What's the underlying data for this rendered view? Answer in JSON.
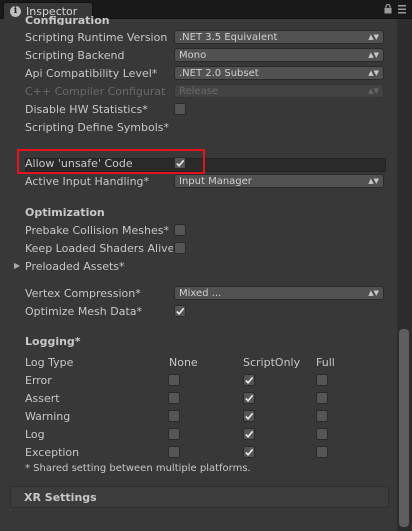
{
  "tab": {
    "title": "Inspector",
    "icon": "info-icon"
  },
  "tab_tools": {
    "lock": "lock-icon",
    "menu": "menu-icon"
  },
  "section_cut_title": "Configuration",
  "config": {
    "scripting_runtime_label": "Scripting Runtime Version",
    "scripting_runtime_value": ".NET 3.5 Equivalent",
    "scripting_backend_label": "Scripting Backend",
    "scripting_backend_value": "Mono",
    "api_compat_label": "Api Compatibility Level*",
    "api_compat_value": ".NET 2.0 Subset",
    "cpp_compiler_label": "C++ Compiler Configurat",
    "cpp_compiler_value": "Release",
    "disable_hw_label": "Disable HW Statistics*",
    "define_symbols_label": "Scripting Define Symbols*",
    "define_symbols_value": "",
    "allow_unsafe_label": "Allow 'unsafe' Code",
    "active_input_label": "Active Input Handling*",
    "active_input_value": "Input Manager"
  },
  "optimization": {
    "title": "Optimization",
    "prebake_label": "Prebake Collision Meshes*",
    "keep_loaded_label": "Keep Loaded Shaders Alive*",
    "preloaded_label": "Preloaded Assets*",
    "vertex_comp_label": "Vertex Compression*",
    "vertex_comp_value": "Mixed ...",
    "optimize_mesh_label": "Optimize Mesh Data*"
  },
  "logging": {
    "title": "Logging*",
    "col_type": "Log Type",
    "col_none": "None",
    "col_script": "ScriptOnly",
    "col_full": "Full",
    "rows": [
      {
        "label": "Error",
        "none": false,
        "script": true,
        "full": false
      },
      {
        "label": "Assert",
        "none": false,
        "script": true,
        "full": false
      },
      {
        "label": "Warning",
        "none": false,
        "script": true,
        "full": false
      },
      {
        "label": "Log",
        "none": false,
        "script": true,
        "full": false
      },
      {
        "label": "Exception",
        "none": false,
        "script": true,
        "full": false
      }
    ],
    "note": "* Shared setting between multiple platforms."
  },
  "xr": {
    "title": "XR Settings"
  },
  "highlight_color": "#e4131d"
}
